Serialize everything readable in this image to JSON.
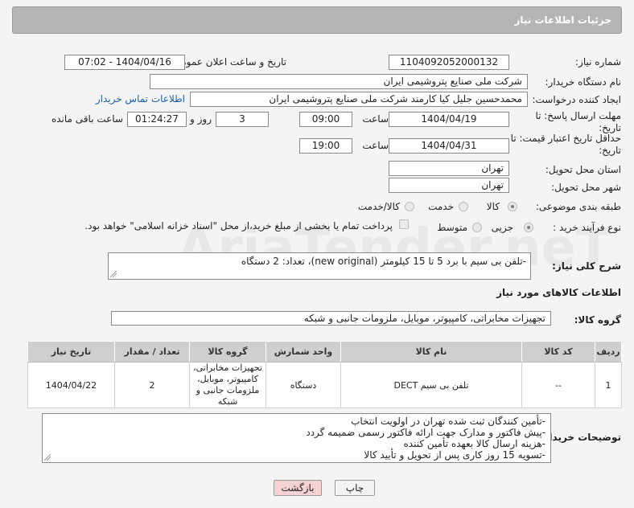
{
  "header": {
    "title": "جزئیات اطلاعات نیاز"
  },
  "form": {
    "need_number_label": "شماره نیاز:",
    "need_number": "1104092052000132",
    "announce_label": "تاریخ و ساعت اعلان عمومی:",
    "announce_value": "1404/04/16 - 07:02",
    "buyer_org_label": "نام دستگاه خریدار:",
    "buyer_org": "شرکت ملی صنایع پتروشیمی ایران",
    "creator_label": "ایجاد کننده درخواست:",
    "creator": "محمدحسین جلیل کیا کارمند شرکت ملی صنایع پتروشیمی ایران",
    "contact_link": "اطلاعات تماس خریدار",
    "reply_deadline_label": "مهلت ارسال پاسخ: تا تاریخ:",
    "reply_date": "1404/04/19",
    "time_label": "ساعت",
    "reply_time": "09:00",
    "days": "3",
    "days_label": "روز و",
    "remaining": "01:24:27",
    "remaining_label": "ساعت باقی مانده",
    "price_deadline_label": "حداقل تاریخ اعتبار قیمت: تا تاریخ:",
    "price_date": "1404/04/31",
    "price_time": "19:00",
    "province_label": "استان محل تحویل:",
    "province": "تهران",
    "city_label": "شهر محل تحویل:",
    "city": "تهران",
    "category_label": "طبقه بندی موضوعی:",
    "category_options": [
      "کالا",
      "خدمت",
      "کالا/خدمت"
    ],
    "process_label": "نوع فرآیند خرید :",
    "process_options": [
      "جزیی",
      "متوسط"
    ],
    "payment_note": "پرداخت تمام یا بخشی از مبلغ خرید،از محل \"اسناد خزانه اسلامی\" خواهد بود."
  },
  "description": {
    "label": "شرح کلی نیاز:",
    "text": "-تلفن بی سیم با برد 5 تا 15 کیلومتر (new original)، تعداد: 2 دستگاه"
  },
  "goods": {
    "section_title": "اطلاعات کالاهای مورد نیاز",
    "group_label": "گروه کالا:",
    "group_value": "تجهیزات مخابراتی، کامپیوتر، موبایل، ملزومات جانبی و شبکه"
  },
  "table": {
    "headers": [
      "ردیف",
      "کد کالا",
      "نام کالا",
      "واحد شمارش",
      "گروه کالا",
      "تعداد / مقدار",
      "تاریخ نیاز"
    ],
    "rows": [
      {
        "row": "1",
        "code": "--",
        "name": "تلفن بی سیم DECT",
        "unit": "دستگاه",
        "group": "تجهیزات مخابراتی، کامپیوتر، موبایل، ملزومات جانبی و شبکه",
        "qty": "2",
        "date": "1404/04/22"
      }
    ]
  },
  "buyer_notes": {
    "label": "توضیحات خریدار:",
    "lines": [
      "-تأمین کنندگان ثبت شده تهران در اولویت انتخاب",
      "-پیش فاکتور و مدارک جهت ارائه فاکتور رسمی ضمیمه گردد",
      "-هزینه ارسال کالا بعهده تأمین کننده",
      "-تسویه 15 روز کاری پس از تحویل و تأیید کالا"
    ]
  },
  "buttons": {
    "print": "چاپ",
    "back": "بازگشت"
  },
  "watermark": {
    "text": "AriaTender.neT"
  },
  "colors": {
    "header_bg": "#b5b5b5",
    "link": "#1b5eaa",
    "back_button_bg": "#f6d3d3"
  }
}
